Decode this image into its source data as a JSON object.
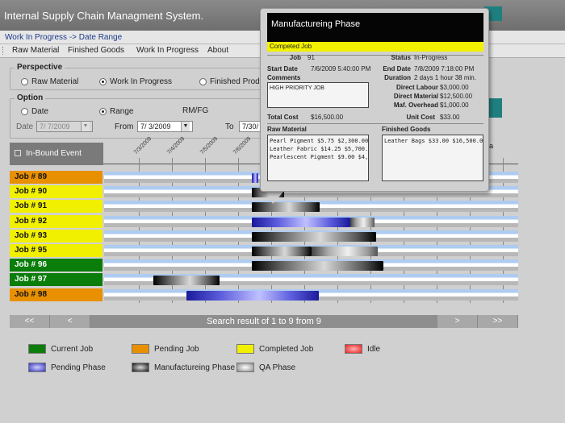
{
  "app": {
    "title": "Internal Supply Chain Managment System."
  },
  "breadcrumb": "Work In Progress -> Date Range",
  "menu": {
    "items": [
      "Raw Material",
      "Finished Goods",
      "Work In Progress",
      "About"
    ]
  },
  "perspective": {
    "legend": "Perspective",
    "options": [
      {
        "label": "Raw Material",
        "selected": false
      },
      {
        "label": "Work In Progress",
        "selected": true
      },
      {
        "label": "Finished Produ",
        "selected": false
      }
    ]
  },
  "option": {
    "legend": "Option",
    "date_label": "Date",
    "range_label": "Range",
    "rmfg_label": "RM/FG",
    "date_field_label": "Date",
    "date_value": "7/ 7/2009",
    "from_label": "From",
    "from_value": "7/ 3/2009",
    "to_label": "To",
    "to_value": "7/30/"
  },
  "gantt": {
    "header": "In-Bound Event",
    "dates": [
      "7/3/2009",
      "7/4/2009",
      "7/5/2009",
      "7/6/2009"
    ],
    "trailing_tick": "a",
    "jobs": [
      {
        "label": "Job # 89",
        "status": "pending"
      },
      {
        "label": "Job # 90",
        "status": "completed"
      },
      {
        "label": "Job # 91",
        "status": "completed"
      },
      {
        "label": "Job # 92",
        "status": "completed"
      },
      {
        "label": "Job # 93",
        "status": "completed"
      },
      {
        "label": "Job # 95",
        "status": "completed"
      },
      {
        "label": "Job # 96",
        "status": "current"
      },
      {
        "label": "Job # 97",
        "status": "current"
      },
      {
        "label": "Job # 98",
        "status": "pending"
      }
    ]
  },
  "pager": {
    "first": "<<",
    "prev": "<",
    "text": "Search result of 1 to 9 from 9",
    "next": ">",
    "last": ">>"
  },
  "legend": [
    {
      "label": "Current Job",
      "color": "#0a7d0a"
    },
    {
      "label": "Pending Job",
      "color": "#e89000"
    },
    {
      "label": "Completed Job",
      "color": "#f0f000"
    },
    {
      "label": "Idle",
      "color": "#e82020"
    },
    {
      "label": "Pending Phase",
      "color": "#3535c0"
    },
    {
      "label": "Manufactureing Phase",
      "color": "#333333"
    },
    {
      "label": "QA Phase",
      "color": "#a0a0a0"
    }
  ],
  "colors": {
    "pending": "#e89000",
    "completed": "#f0f000",
    "current": "#0a7d0a",
    "row_light": "#aecbf0",
    "row_white": "#ffffff",
    "row_gray": "#b8b8b8"
  },
  "popup": {
    "title": "Manufactureing Phase",
    "status_strip": "Competed Job",
    "job_label": "Job",
    "job_value": "91",
    "status_label": "Status",
    "status_value": "In-Progress",
    "start_label": "Start Date",
    "start_value": "7/6/2009 5:40:00 PM",
    "end_label": "End Date",
    "end_value": "7/8/2009 7:18:00 PM",
    "comments_label": "Comments",
    "duration_label": "Duration",
    "duration_value": "2 days 1 hour 38 min.",
    "comments_text": "HIGH PRIORITY JOB",
    "direct_labour_label": "Direct Labour",
    "direct_labour_value": "$3,000.00",
    "direct_material_label": "Direct Material",
    "direct_material_value": "$12,500.00",
    "maf_overhead_label": "Maf. Overhead",
    "maf_overhead_value": "$1,000.00",
    "total_cost_label": "Total Cost",
    "total_cost_value": "$16,500.00",
    "unit_cost_label": "Unit Cost",
    "unit_cost_value": "$33.00",
    "raw_material_label": "Raw Material",
    "raw_material_lines": [
      "Pearl Pigment  $5.75  $2,300.00",
      "Leather Fabric  $14.25  $5,700.0",
      "Pearlescent Pigment  $9.00  $4,5"
    ],
    "finished_goods_label": "Finished Goods",
    "finished_goods_lines": [
      "Leather Bags  $33.00  $16,500.0"
    ]
  }
}
